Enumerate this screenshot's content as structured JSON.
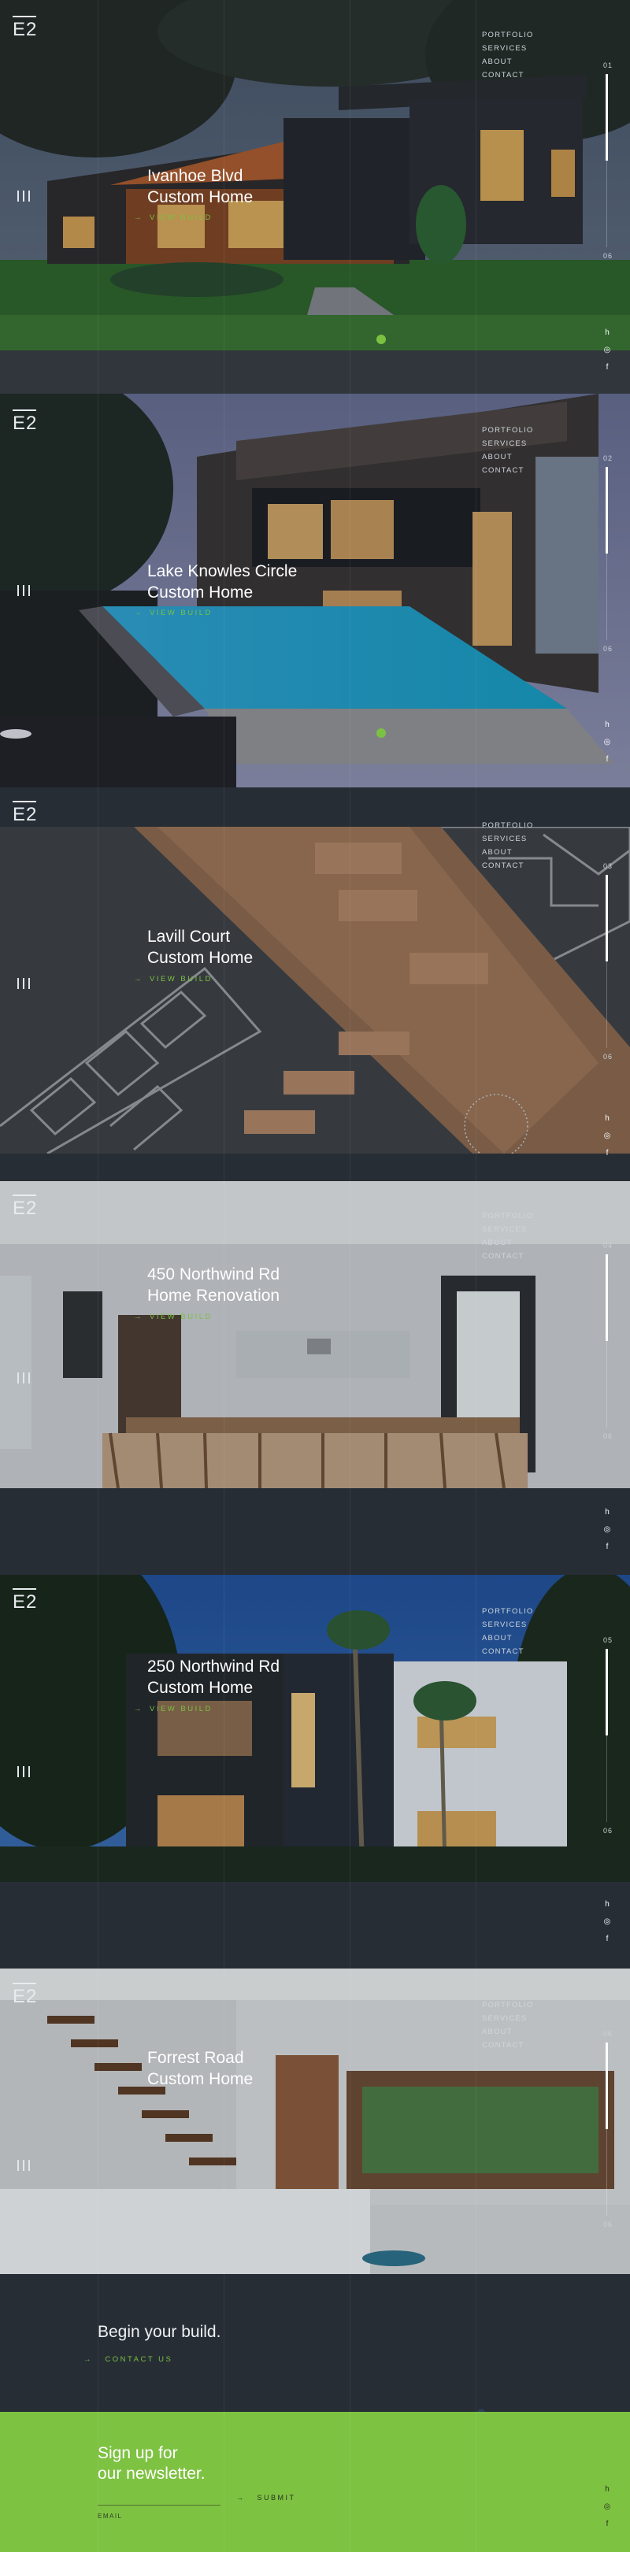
{
  "brand": {
    "logo": "E2"
  },
  "nav": [
    "PORTFOLIO",
    "SERVICES",
    "ABOUT",
    "CONTACT"
  ],
  "projects": [
    {
      "title_line1": "Ivanhoe Blvd",
      "title_line2": "Custom Home",
      "link": "VIEW BUILD",
      "progress_from": "01",
      "progress_to": "06"
    },
    {
      "title_line1": "Lake Knowles Circle",
      "title_line2": "Custom Home",
      "link": "VIEW BUILD",
      "progress_from": "02",
      "progress_to": "06"
    },
    {
      "title_line1": "Lavill Court",
      "title_line2": "Custom Home",
      "link": "VIEW BUILD",
      "progress_from": "03",
      "progress_to": "06"
    },
    {
      "title_line1": "450 Northwind Rd",
      "title_line2": "Home Renovation",
      "link": "VIEW BUILD",
      "progress_from": "04",
      "progress_to": "06"
    },
    {
      "title_line1": "250 Northwind Rd",
      "title_line2": "Custom Home",
      "link": "VIEW BUILD",
      "progress_from": "05",
      "progress_to": "06"
    },
    {
      "title_line1": "Forrest Road",
      "title_line2": "Custom Home",
      "link": "VIEW BUILD",
      "progress_from": "06",
      "progress_to": "06"
    }
  ],
  "social_icons": [
    "houzz-icon",
    "instagram-icon",
    "facebook-icon"
  ],
  "cta": {
    "heading": "Begin your build.",
    "link": "CONTACT US"
  },
  "newsletter": {
    "heading_line1": "Sign up for",
    "heading_line2": "our newsletter.",
    "email_label": "EMAIL",
    "email_value": "",
    "submit": "SUBMIT"
  },
  "colors": {
    "accent": "#7ec242",
    "dark": "#272d35"
  }
}
